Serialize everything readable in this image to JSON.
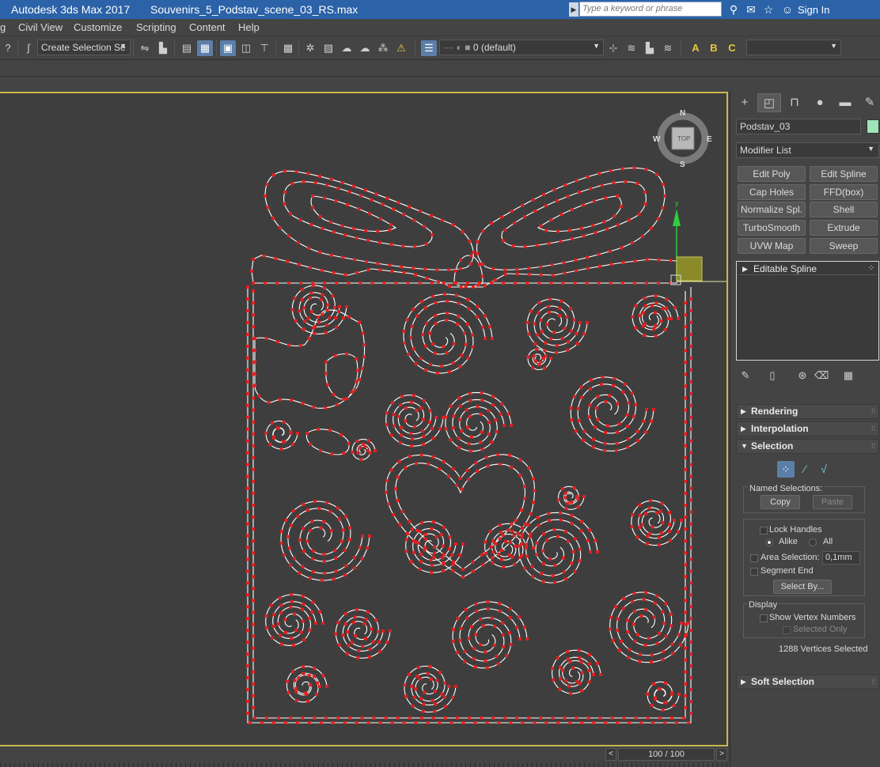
{
  "titlebar": {
    "app_title": "Autodesk 3ds Max 2017",
    "file_name": "Souvenirs_5_Podstav_scene_03_RS.max",
    "search_placeholder": "Type a keyword or phrase",
    "sign_in": "Sign In",
    "color": "#2b62a8"
  },
  "menu": {
    "items": [
      "g",
      "Civil View",
      "Customize",
      "Scripting",
      "Content",
      "Help"
    ]
  },
  "toolbar": {
    "selection_set": "Create Selection Se",
    "layer": "0 (default)",
    "icons": [
      "undo-icon",
      "select-filter-icon",
      "select-object-icon",
      "select-by-name-icon",
      "rectangle-select-icon",
      "window-crossing-icon",
      "mirror-icon",
      "align-icon",
      "layer-manager-icon",
      "scene-explorer-icon",
      "warning-icon",
      "render-setup-icon",
      "text-a-icon",
      "text-b-icon",
      "text-c-icon"
    ]
  },
  "viewport": {
    "viewcube_label": "TOP",
    "compass": {
      "n": "N",
      "s": "S",
      "e": "E",
      "w": "W"
    },
    "gizmo_axis_label": "y",
    "border_color": "#c9b84b",
    "vertex_color": "#e02020",
    "spline_color": "#ffffff"
  },
  "timeline": {
    "frame": "100 / 100",
    "prev": "<",
    "next": ">"
  },
  "panel": {
    "object_name": "Podstav_03",
    "object_color": "#9ee6b9",
    "modifier_list": "Modifier List",
    "modifier_buttons": [
      "Edit Poly",
      "Edit Spline",
      "Cap Holes",
      "FFD(box)",
      "Normalize Spl.",
      "Shell",
      "TurboSmooth",
      "Extrude",
      "UVW Map",
      "Sweep"
    ],
    "stack_item": "Editable Spline",
    "rollouts": {
      "rendering": "Rendering",
      "interpolation": "Interpolation",
      "selection": "Selection",
      "soft_selection": "Soft Selection"
    },
    "selection": {
      "named_selections": "Named Selections:",
      "copy": "Copy",
      "paste": "Paste",
      "lock_handles": "Lock Handles",
      "alike": "Alike",
      "all": "All",
      "area_selection": "Area Selection:",
      "area_value": "0,1mm",
      "segment_end": "Segment End",
      "select_by": "Select By...",
      "display": "Display",
      "show_vertex_numbers": "Show Vertex Numbers",
      "selected_only": "Selected Only",
      "status": "1288 Vertices Selected"
    }
  }
}
